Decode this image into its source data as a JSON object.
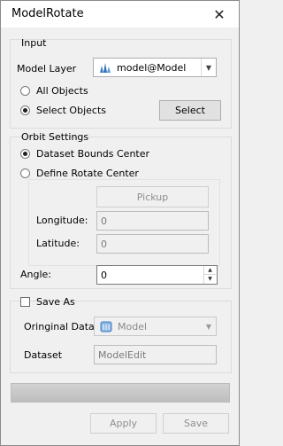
{
  "window": {
    "title": "ModelRotate",
    "close_icon": "✕"
  },
  "input_group": {
    "title": "Input",
    "model_layer_label": "Model Layer",
    "model_layer_value": "model@Model",
    "all_objects_label": "All Objects",
    "select_objects_label": "Select Objects",
    "select_button": "Select",
    "selected_mode": "select_objects"
  },
  "orbit_group": {
    "title": "Orbit Settings",
    "dataset_bounds_center_label": "Dataset Bounds Center",
    "define_rotate_center_label": "Define Rotate Center",
    "selected_mode": "dataset_bounds_center",
    "pickup_button": "Pickup",
    "longitude_label": "Longitude:",
    "longitude_value": "0",
    "latitude_label": "Latitude:",
    "latitude_value": "0"
  },
  "angle": {
    "label": "Angle:",
    "value": "0"
  },
  "save_as_group": {
    "checkbox_label": "Save As",
    "checked": false,
    "original_data_label": "Oringinal Data",
    "original_data_value": "Model",
    "dataset_label": "Dataset",
    "dataset_value": "ModelEdit"
  },
  "progress": {
    "fraction": 1.0
  },
  "footer": {
    "apply_button": "Apply",
    "save_button": "Save"
  },
  "colors": {
    "accent": "#1f5fb4",
    "window_bg": "#f0f0f0"
  }
}
